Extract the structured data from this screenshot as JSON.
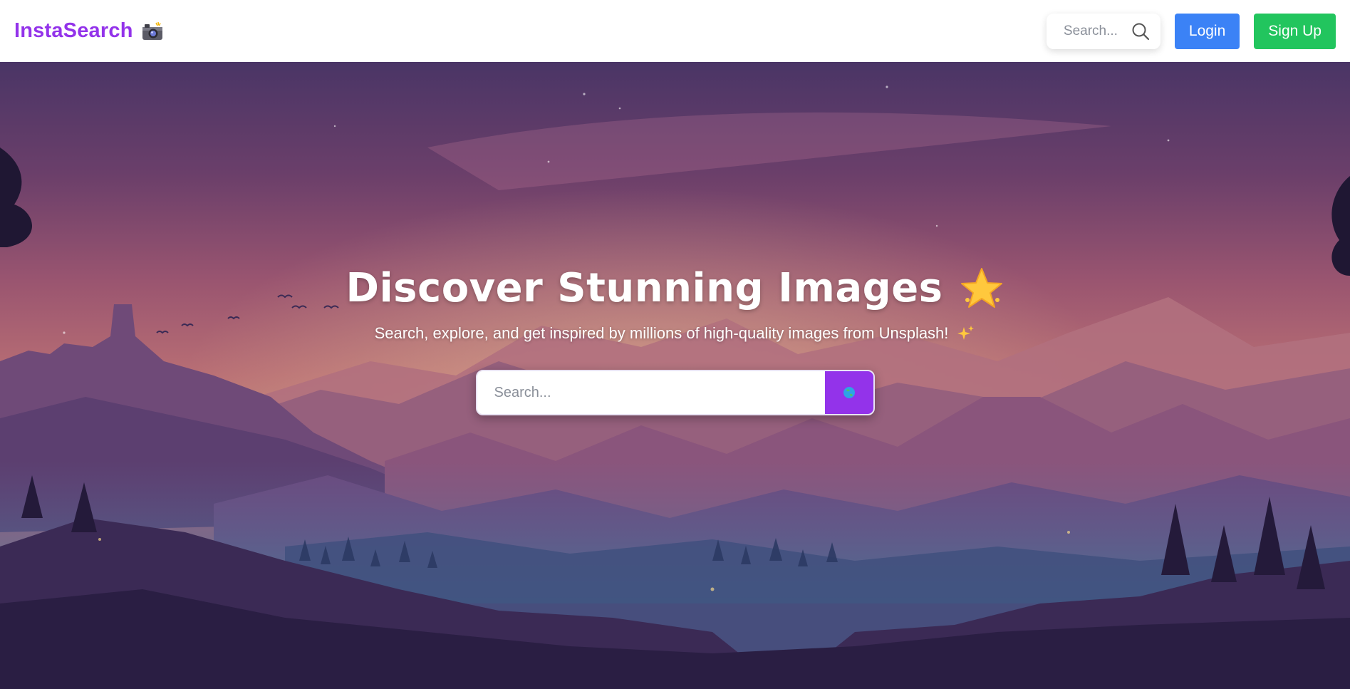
{
  "navbar": {
    "brand": "InstaSearch",
    "brand_icon": "camera-icon",
    "search_placeholder": "Search...",
    "login_label": "Login",
    "signup_label": "Sign Up"
  },
  "hero": {
    "title": "Discover Stunning Images",
    "title_icon": "star-icon",
    "subtitle": "Search, explore, and get inspired by millions of high-quality images from Unsplash!",
    "subtitle_icon": "sparkle-icon",
    "search_placeholder": "Search...",
    "search_button_icon": "globe-icon"
  },
  "colors": {
    "brand": "#9333ea",
    "login": "#3b82f6",
    "signup": "#22c55e",
    "search_button": "#9333ea"
  }
}
